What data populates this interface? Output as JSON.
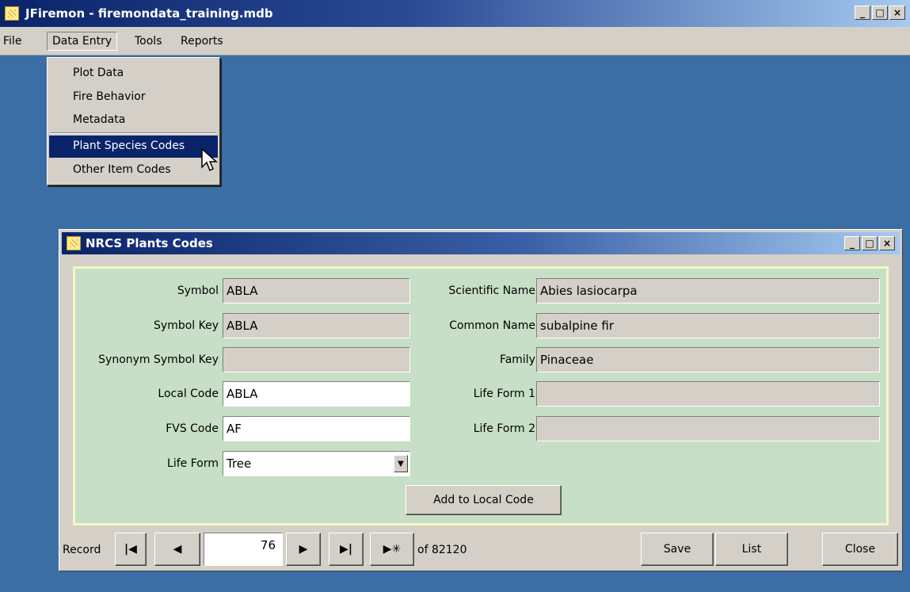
{
  "app": {
    "title": "JFiremon - firemondata_training.mdb",
    "min": "_",
    "max": "□",
    "close": "×"
  },
  "menu": {
    "file": "File",
    "data_entry": "Data Entry",
    "tools": "Tools",
    "reports": "Reports"
  },
  "dropdown": {
    "items": [
      "Plot Data",
      "Fire Behavior",
      "Metadata",
      "Plant Species Codes",
      "Other Item Codes"
    ],
    "selected": "Plant Species Codes"
  },
  "form": {
    "title": "NRCS Plants Codes",
    "labels": {
      "symbol": "Symbol",
      "symbol_key": "Symbol Key",
      "synonym_symbol_key": "Synonym Symbol Key",
      "local_code": "Local Code",
      "fvs_code": "FVS Code",
      "life_form": "Life Form",
      "scientific_name": "Scientific Name",
      "common_name": "Common Name",
      "family": "Family",
      "life_form_1": "Life Form 1",
      "life_form_2": "Life Form 2"
    },
    "values": {
      "symbol": "ABLA",
      "symbol_key": "ABLA",
      "synonym_symbol_key": "",
      "local_code": "ABLA",
      "fvs_code": "AF",
      "life_form": "Tree",
      "scientific_name": "Abies lasiocarpa",
      "common_name": "subalpine fir",
      "family": "Pinaceae",
      "life_form_1": "",
      "life_form_2": ""
    },
    "add_button": "Add to Local Code"
  },
  "nav": {
    "record_label": "Record",
    "first": "⏮",
    "prev": "◀",
    "current": "76",
    "next": "▶",
    "last": "⏭",
    "new": "▶✳",
    "of_text": "of 82120",
    "save": "Save",
    "list": "List",
    "close": "Close"
  },
  "colors": {
    "desktop": "#3a6ea5",
    "titlebar": "#0a246a",
    "form_panel": "#c6dfc6",
    "panel_border": "#f6f7c3",
    "chrome": "#d4d0c8"
  }
}
